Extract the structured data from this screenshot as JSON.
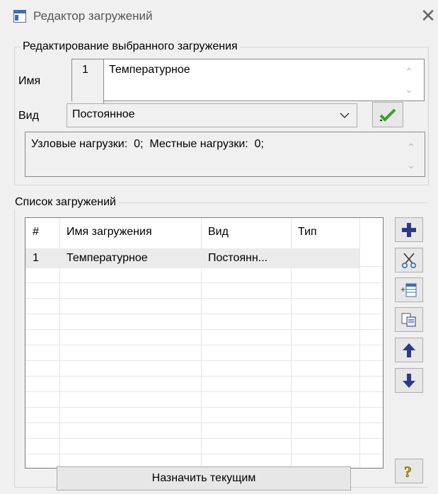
{
  "window": {
    "title": "Редактор загружений",
    "close_icon": "close-icon"
  },
  "edit_group": {
    "legend": "Редактирование выбранного загружения",
    "name_label": "Имя",
    "load_number": "1",
    "name_value": "Температурное",
    "kind_label": "Вид",
    "kind_value": "Постоянное",
    "info_text": "Узловые нагрузки:  0;  Местные нагрузки:  0;"
  },
  "list_group": {
    "legend": "Список загружений",
    "columns": [
      "#",
      "Имя загружения",
      "Вид",
      "Тип"
    ],
    "rows": [
      {
        "num": "1",
        "name": "Температурное",
        "kind": "Постоянн...",
        "type": ""
      }
    ]
  },
  "assign_button": "Назначить текущим",
  "colors": {
    "accent_blue": "#2d3a8c",
    "check_green": "#3aa02a",
    "help_yellow": "#c8a800"
  }
}
